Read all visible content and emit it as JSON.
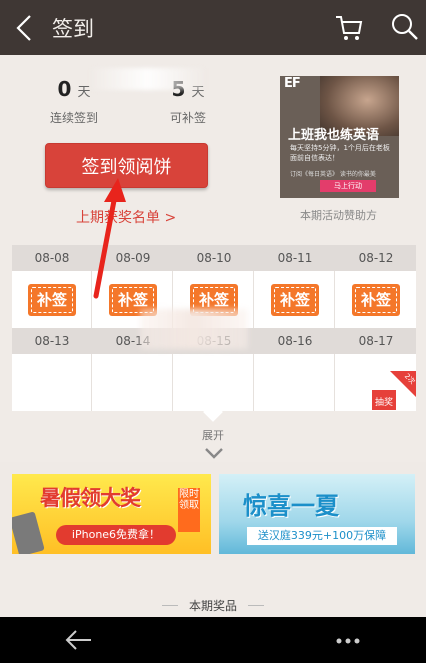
{
  "header": {
    "title": "签到",
    "icons": [
      "back-arrow-icon",
      "cart-icon",
      "search-icon"
    ]
  },
  "stats": {
    "consecutive_num": "0",
    "consecutive_unit": "天",
    "consecutive_label": "连续签到",
    "makeup_num": "5",
    "makeup_unit": "天",
    "makeup_label": "可补签"
  },
  "signin_button": "签到领阅饼",
  "winners_link": "上期获奖名单 >",
  "ad": {
    "logo": "EF",
    "title": "上班我也练英语",
    "sub": "每天坚持5分钟，1个月后在老板面前自信表达！",
    "sub2": "订阅《每日英语》 读书的你最美",
    "go": "马上行动",
    "sponsor_label": "本期活动赞助方"
  },
  "calendar": {
    "row1_dates": [
      "08-08",
      "08-09",
      "08-10",
      "08-11",
      "08-12"
    ],
    "row2_dates": [
      "08-13",
      "08-14",
      "08-15",
      "08-16",
      "08-17"
    ],
    "makeup_label": "补签",
    "gift_label": "抽奖",
    "gift_badge": "2次"
  },
  "expand_label": "展开",
  "banners": {
    "banner1_title": "暑假领大奖",
    "banner1_tag": "限时领取",
    "banner1_sub": "iPhone6免费拿！",
    "banner2_title": "惊喜一夏",
    "banner2_sub": "送汉庭339元+100万保障"
  },
  "prize_label": "本期奖品",
  "colors": {
    "header_bg": "#3f3734",
    "accent_red": "#d8433a",
    "makeup_orange": "#f4772a",
    "page_bg": "#f0ebe7"
  }
}
